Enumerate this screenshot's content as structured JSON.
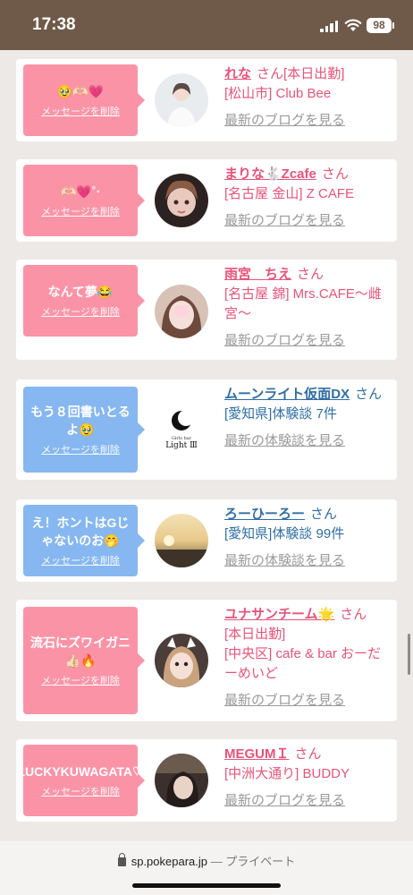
{
  "status_bar": {
    "time": "17:38",
    "battery": "98"
  },
  "cards": [
    {
      "bubble_color": "pink",
      "bubble_text": "🥹🫶🏻💗",
      "delete_label": "メッセージを削除",
      "name": "れな",
      "san": "さん",
      "name_suffix": "[本日出勤]",
      "lines": [
        "[松山市] Club Bee"
      ],
      "link_label": "最新のブログを見る",
      "link_color": "pink"
    },
    {
      "bubble_color": "pink",
      "bubble_text": "🫶🏻💗˚‧",
      "delete_label": "メッセージを削除",
      "name": "まりな🐇Zcafe",
      "san": "さん",
      "name_suffix": "",
      "lines": [
        "[名古屋 金山] Z CAFE"
      ],
      "link_label": "最新のブログを見る",
      "link_color": "pink"
    },
    {
      "bubble_color": "pink",
      "bubble_text": "なんて夢😂",
      "delete_label": "メッセージを削除",
      "name": "雨宮　ちえ",
      "san": "さん",
      "name_suffix": "",
      "lines": [
        "[名古屋 錦] Mrs.CAFE～雌宮～"
      ],
      "link_label": "最新のブログを見る",
      "link_color": "pink"
    },
    {
      "bubble_color": "blue",
      "bubble_text": "もう８回書いとるよ🥹",
      "delete_label": "メッセージを削除",
      "name": "ムーンライト仮面DX",
      "san": "さん",
      "name_suffix": "",
      "lines": [
        "[愛知県]体験談 7件"
      ],
      "link_label": "最新の体験談を見る",
      "link_color": "blue"
    },
    {
      "bubble_color": "blue",
      "bubble_text": "え！ホントはGじゃないのお🤭",
      "delete_label": "メッセージを削除",
      "name": "ろーひーろー",
      "san": "さん",
      "name_suffix": "",
      "lines": [
        "[愛知県]体験談 99件"
      ],
      "link_label": "最新の体験談を見る",
      "link_color": "blue"
    },
    {
      "bubble_color": "pink",
      "bubble_text": "流石にズワイガニ👍🏻🔥",
      "delete_label": "メッセージを削除",
      "name": "ユナサンチーム🌟",
      "san": "さん",
      "name_suffix": "",
      "lines": [
        "[本日出勤]",
        "[中央区] cafe & bar おーだーめいど"
      ],
      "link_label": "最新のブログを見る",
      "link_color": "pink"
    },
    {
      "bubble_color": "pink",
      "bubble_text": "LUCKYKUWAGATA♡",
      "delete_label": "メッセージを削除",
      "name": "MEGUMＩ",
      "san": "さん",
      "name_suffix": "",
      "lines": [
        "[中洲大通り] BUDDY"
      ],
      "link_label": "最新のブログを見る",
      "link_color": "pink"
    }
  ],
  "avatar_logo": {
    "line1": "Girls bar",
    "line2": "Light Ⅲ"
  },
  "url_bar": {
    "domain": "sp.pokepara.jp",
    "separator": "—",
    "mode": "プライベート"
  }
}
